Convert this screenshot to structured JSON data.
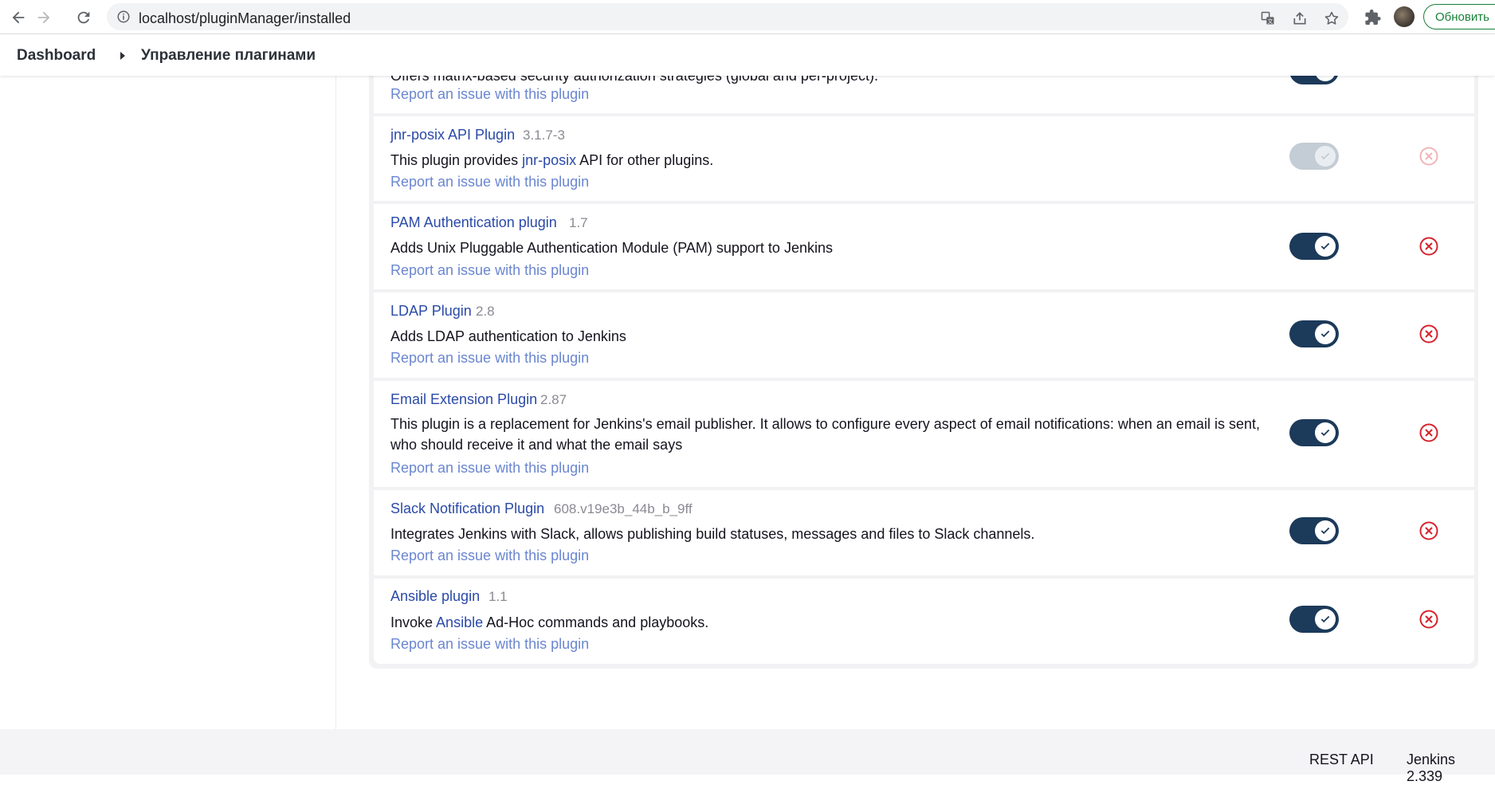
{
  "browser": {
    "url": "localhost/pluginManager/installed",
    "update_label": "Обновить"
  },
  "breadcrumb": {
    "items": [
      "Dashboard",
      "Управление плагинами"
    ]
  },
  "top_partial": {
    "desc": "Offers matrix-based security authorization strategies (global and per-project).",
    "report": "Report an issue with this plugin"
  },
  "plugins": [
    {
      "name": "jnr-posix API Plugin",
      "version": "3.1.7-3",
      "desc_prefix": "This plugin provides ",
      "desc_link": "jnr-posix",
      "desc_suffix": " API for other plugins.",
      "report": "Report an issue with this plugin",
      "enabled": true,
      "toggle_disabled": true
    },
    {
      "name": "PAM Authentication plugin",
      "version": "1.7",
      "desc": "Adds Unix Pluggable Authentication Module (PAM) support to Jenkins",
      "report": "Report an issue with this plugin",
      "enabled": true
    },
    {
      "name": "LDAP Plugin",
      "version": "2.8",
      "desc": "Adds LDAP authentication to Jenkins",
      "report": "Report an issue with this plugin",
      "enabled": true
    },
    {
      "name": "Email Extension Plugin",
      "version": "2.87",
      "desc_line1": "This plugin is a replacement for Jenkins's email publisher. It allows to configure every aspect of email notifications: when an email is sent,",
      "desc_line2": "who should receive it and what the email says",
      "report": "Report an issue with this plugin",
      "enabled": true
    },
    {
      "name": "Slack Notification Plugin",
      "version": "608.v19e3b_44b_b_9ff",
      "desc": "Integrates Jenkins with Slack, allows publishing build statuses, messages and files to Slack channels.",
      "report": "Report an issue with this plugin",
      "enabled": true
    },
    {
      "name": "Ansible plugin",
      "version": "1.1",
      "desc_prefix": "Invoke ",
      "desc_link": "Ansible",
      "desc_suffix": " Ad-Hoc commands and playbooks.",
      "report": "Report an issue with this plugin",
      "enabled": true
    }
  ],
  "footer": {
    "rest_api": "REST API",
    "version": "Jenkins 2.339"
  },
  "colors": {
    "link": "#2b4aa8",
    "report_link": "#6a86d0",
    "toggle_on": "#1c3a5a",
    "toggle_disabled": "#c4ccd5",
    "uninstall": "#d6242e",
    "uninstall_disabled": "#f0b5b8"
  },
  "icons": [
    "back-arrow-icon",
    "forward-arrow-icon",
    "reload-icon",
    "info-icon",
    "translate-icon",
    "share-icon",
    "star-icon",
    "extensions-icon",
    "check-icon",
    "uninstall-x-icon"
  ]
}
